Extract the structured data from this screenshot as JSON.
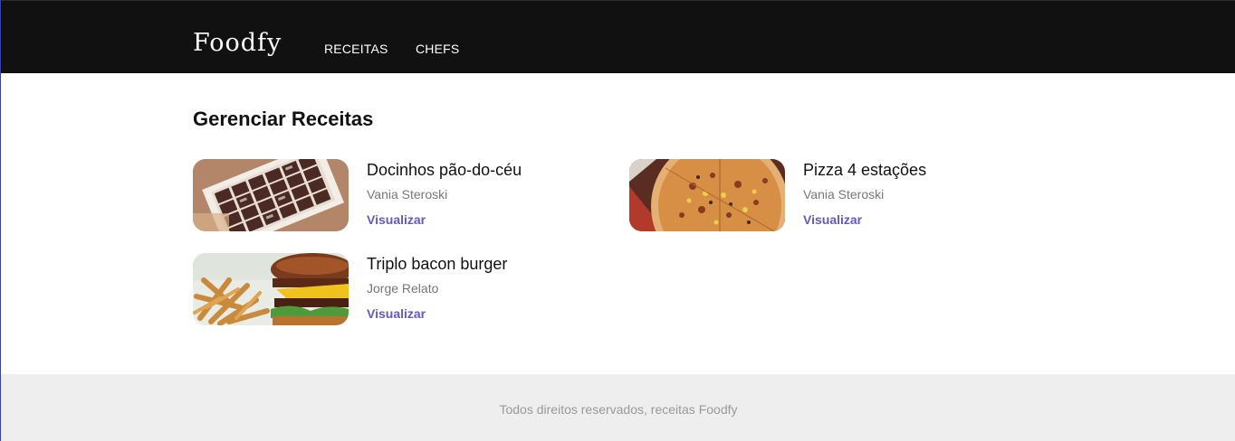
{
  "header": {
    "logo": "Foodfy",
    "nav": [
      {
        "label": "RECEITAS"
      },
      {
        "label": "CHEFS"
      }
    ]
  },
  "main": {
    "title": "Gerenciar Receitas",
    "recipes": [
      {
        "title": "Docinhos pão-do-céu",
        "author": "Vania Steroski",
        "link": "Visualizar",
        "image": "chocolate-box-image"
      },
      {
        "title": "Pizza 4 estações",
        "author": "Vania Steroski",
        "link": "Visualizar",
        "image": "pizza-image"
      },
      {
        "title": "Triplo bacon burger",
        "author": "Jorge Relato",
        "link": "Visualizar",
        "image": "burger-fries-image"
      }
    ]
  },
  "footer": {
    "text": "Todos direitos reservados, receitas Foodfy"
  },
  "colors": {
    "header_bg": "#111111",
    "accent": "#6558c3",
    "footer_bg": "#eeeeee"
  }
}
